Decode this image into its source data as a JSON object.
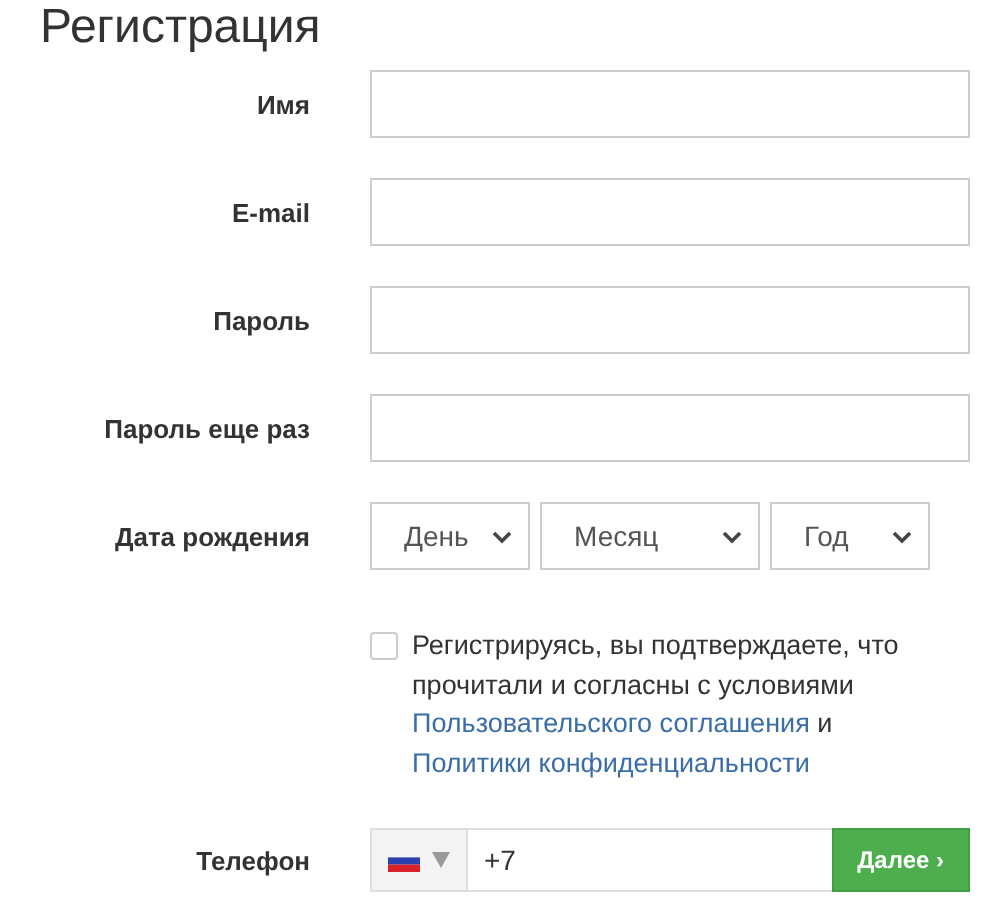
{
  "title": "Регистрация",
  "fields": [
    {
      "label": "Имя"
    },
    {
      "label": "E-mail"
    },
    {
      "label": "Пароль"
    },
    {
      "label": "Пароль еще раз"
    }
  ],
  "birth_date": {
    "label": "Дата рождения",
    "selects": [
      {
        "value": "День",
        "kind": "day"
      },
      {
        "value": "Месяц",
        "kind": "month"
      },
      {
        "value": "Год",
        "kind": "year"
      }
    ]
  },
  "consent": {
    "checked": false,
    "text": "Регистрируясь, вы подтверждаете, что прочитали и согласны с условиями",
    "links": [
      "Пользовательского соглашения",
      "Политики конфиденциальности"
    ],
    "joiner": "и"
  },
  "phone": {
    "label": "Телефон",
    "value": "+7",
    "button": "Далее ›"
  }
}
